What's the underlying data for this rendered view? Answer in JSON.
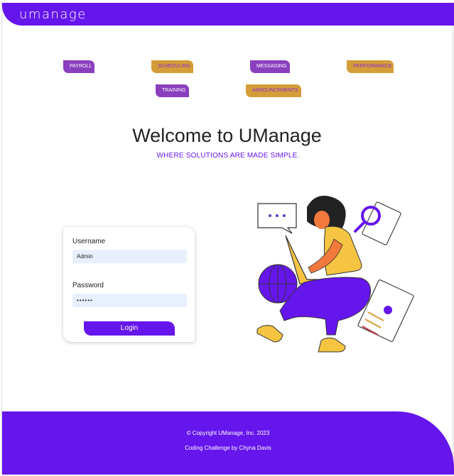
{
  "header": {
    "logo": "umanage"
  },
  "tags": [
    {
      "label": "PAYROLL",
      "style": "purple"
    },
    {
      "label": "SCHEDULING",
      "style": "gold"
    },
    {
      "label": "MESSAGING",
      "style": "purple"
    },
    {
      "label": "PERFORMANCE",
      "style": "gold"
    },
    {
      "label": "TRAINING",
      "style": "purple"
    },
    {
      "label": "ANNOUNCEMENTS",
      "style": "gold"
    }
  ],
  "hero": {
    "title": "Welcome to UManage",
    "subtitle": "WHERE SOLUTIONS ARE MADE SIMPLE."
  },
  "login": {
    "username_label": "Username",
    "username_value": "Admin",
    "password_label": "Password",
    "password_value": "••••••",
    "button": "Login"
  },
  "illustration": {
    "icon": "person-with-laptop-illustration"
  },
  "footer": {
    "copyright": "© Copyright UManage, Inc. 2023",
    "credit": "Coding Challenge by Chyna Davis"
  },
  "colors": {
    "brand": "#6516ec",
    "tag_purple": "#8a3fbf",
    "tag_gold": "#d49d38",
    "input_bg": "#e8f0fe"
  }
}
